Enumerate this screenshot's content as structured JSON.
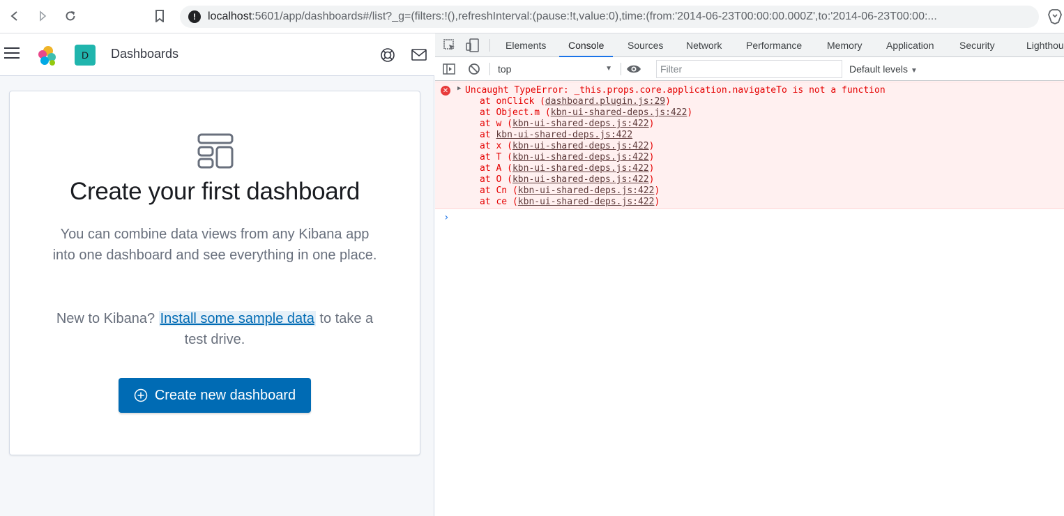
{
  "browser": {
    "url_host": "localhost",
    "url_rest": ":5601/app/dashboards#/list?_g=(filters:!(),refreshInterval:(pause:!t,value:0),time:(from:'2014-06-23T00:00:00.000Z',to:'2014-06-23T00:00:..."
  },
  "kibana": {
    "space_initial": "D",
    "app_title": "Dashboards",
    "empty_state": {
      "title": "Create your first dashboard",
      "body": "You can combine data views from any Kibana app into one dashboard and see everything in one place.",
      "sample_prefix": "New to Kibana?",
      "sample_link": "Install some sample data",
      "sample_suffix": "to take a test drive.",
      "create_button": "Create new dashboard"
    }
  },
  "devtools": {
    "tabs": [
      "Elements",
      "Console",
      "Sources",
      "Network",
      "Performance",
      "Memory",
      "Application",
      "Security",
      "Lighthouse"
    ],
    "active_tab": "Console",
    "context": "top",
    "filter_placeholder": "Filter",
    "levels": "Default levels",
    "error": {
      "message": "Uncaught TypeError: _this.props.core.application.navigateTo is not a function",
      "stack": [
        {
          "prefix": "at onClick (",
          "link": "dashboard.plugin.js:29",
          "suffix": ")"
        },
        {
          "prefix": "at Object.m (",
          "link": "kbn-ui-shared-deps.js:422",
          "suffix": ")"
        },
        {
          "prefix": "at w (",
          "link": "kbn-ui-shared-deps.js:422",
          "suffix": ")"
        },
        {
          "prefix": "at ",
          "link": "kbn-ui-shared-deps.js:422",
          "suffix": ""
        },
        {
          "prefix": "at x (",
          "link": "kbn-ui-shared-deps.js:422",
          "suffix": ")"
        },
        {
          "prefix": "at T (",
          "link": "kbn-ui-shared-deps.js:422",
          "suffix": ")"
        },
        {
          "prefix": "at A (",
          "link": "kbn-ui-shared-deps.js:422",
          "suffix": ")"
        },
        {
          "prefix": "at O (",
          "link": "kbn-ui-shared-deps.js:422",
          "suffix": ")"
        },
        {
          "prefix": "at Cn (",
          "link": "kbn-ui-shared-deps.js:422",
          "suffix": ")"
        },
        {
          "prefix": "at ce (",
          "link": "kbn-ui-shared-deps.js:422",
          "suffix": ")"
        }
      ]
    }
  }
}
